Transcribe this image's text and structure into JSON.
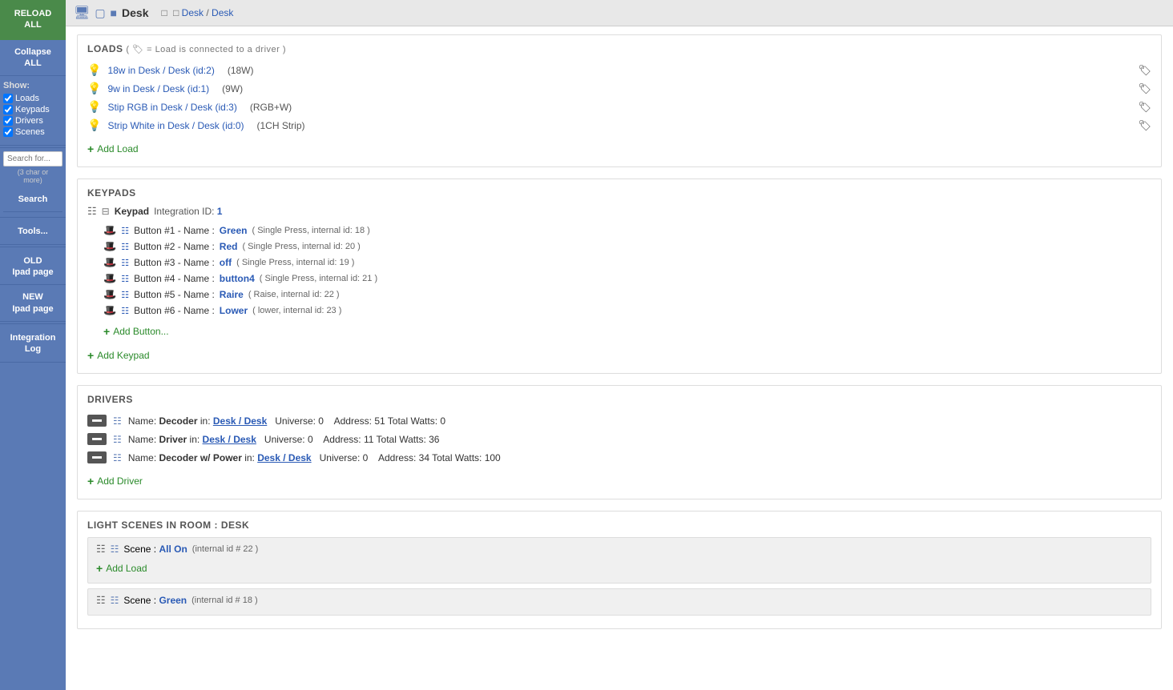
{
  "sidebar": {
    "reload_label": "RELOAD\nALL",
    "collapse_label": "Collapse\nALL",
    "show_label": "Show:",
    "checkboxes": [
      {
        "id": "loads",
        "label": "Loads",
        "checked": true
      },
      {
        "id": "keypads",
        "label": "Keypads",
        "checked": true
      },
      {
        "id": "drivers",
        "label": "Drivers",
        "checked": true
      },
      {
        "id": "scenes",
        "label": "Scenes",
        "checked": true
      }
    ],
    "search_placeholder": "Search for...",
    "search_hint": "(3 char or\nmore)",
    "search_btn": "Search",
    "tools_btn": "Tools...",
    "old_ipad_btn": "OLD\nIpad page",
    "new_ipad_btn": "NEW\nIpad page",
    "integration_log_btn": "Integration\nLog"
  },
  "topbar": {
    "title": "Desk",
    "breadcrumb_room": "Desk",
    "breadcrumb_sep": "/",
    "breadcrumb_page": "Desk"
  },
  "loads_section": {
    "title": "LOADS",
    "subtitle": "( 🏷 = Load is connected to a driver )",
    "items": [
      {
        "label": "18w in Desk / Desk (id:2)",
        "type": "(18W)"
      },
      {
        "label": "9w in Desk / Desk (id:1)",
        "type": "(9W)"
      },
      {
        "label": "Stip RGB in Desk / Desk (id:3)",
        "type": "(RGB+W)"
      },
      {
        "label": "Strip White in Desk / Desk (id:0)",
        "type": "(1CH Strip)"
      }
    ],
    "add_label": "Add Load"
  },
  "keypads_section": {
    "title": "KEYPADS",
    "keypad_name": "Keypad",
    "keypad_integration_label": "Integration ID:",
    "keypad_integration_id": "1",
    "buttons": [
      {
        "num": "#1",
        "name": "Green",
        "detail": "( Single Press, internal id: 18 )"
      },
      {
        "num": "#2",
        "name": "Red",
        "detail": "( Single Press, internal id: 20 )"
      },
      {
        "num": "#3",
        "name": "off",
        "detail": "( Single Press, internal id: 19 )"
      },
      {
        "num": "#4",
        "name": "button4",
        "detail": "( Single Press, internal id: 21 )"
      },
      {
        "num": "#5",
        "name": "Raire",
        "detail": "( Raise, internal id: 22 )"
      },
      {
        "num": "#6",
        "name": "Lower",
        "detail": "( lower, internal id: 23 )"
      }
    ],
    "add_button_label": "Add Button...",
    "add_keypad_label": "Add Keypad"
  },
  "drivers_section": {
    "title": "DRIVERS",
    "items": [
      {
        "name": "Decoder",
        "location": "Desk / Desk",
        "universe": "0",
        "address": "51",
        "watts": "0"
      },
      {
        "name": "Driver",
        "location": "Desk / Desk",
        "universe": "0",
        "address": "11",
        "watts": "36"
      },
      {
        "name": "Decoder w/ Power",
        "location": "Desk / Desk",
        "universe": "0",
        "address": "34",
        "watts": "100"
      }
    ],
    "add_label": "Add Driver"
  },
  "scenes_section": {
    "title": "Light Scenes in room : Desk",
    "scenes": [
      {
        "name": "All On",
        "detail": "(internal id # 22 )",
        "add_load": "Add Load"
      },
      {
        "name": "Green",
        "detail": "(internal id # 18 )"
      }
    ]
  }
}
